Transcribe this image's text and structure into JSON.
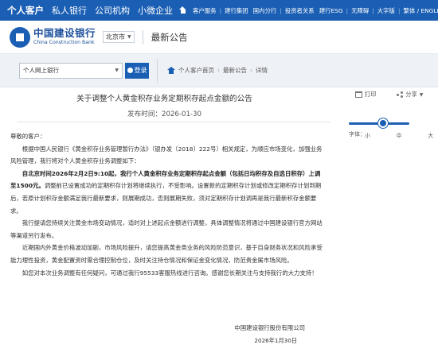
{
  "topbar": {
    "left_items": [
      "个人客户",
      "私人银行",
      "公司机构",
      "小微企业"
    ],
    "right_items": [
      "客户服务",
      "建行集团",
      "国内分行",
      "投资者关系",
      "建行ESG",
      "无障碍",
      "大字版",
      "繁体 / ENGLISH"
    ]
  },
  "header": {
    "logo_cn": "中国建设银行",
    "logo_en": "China Construction Bank",
    "region": "北京市",
    "title": "最新公告"
  },
  "band": {
    "login_select": "个人网上银行",
    "login_button": "登录",
    "breadcrumb": [
      "个人客户首页",
      "最新公告",
      "详情"
    ]
  },
  "article": {
    "title": "关于调整个人黄金积存业务定期积存起点金额的公告",
    "date": "发布时间：2026-01-30",
    "greeting": "尊敬的客户：",
    "p1": "根据中国人民银行《黄金积存业务管理暂行办法》（银办发〔2018〕222号）相关规定，为顺应市场变化，加强业务风险管理，我行将对个人黄金积存业务调整如下：",
    "p2_bold": "自北京时间2026年2月2日9:10起，我行个人黄金积存业务定期积存起点金额（包括日均积存及自选日积存）上调至1500元。",
    "p2_rest": "调整前已设置成功的定期积存计划将继续执行，不受影响。设置新的定期积存计划或修改定期积存计划到期后，若原计划积存金额满足我行最新要求，则展期成功，否则展期失败，须对定期积存计划调再是我行最新积存金额要求。",
    "p3": "我行提请您持续关注黄金市场变动情况，适时对上述起点金额进行调整，具体调整情况将通过中国建设银行官方网站等渠道另行发布。",
    "p4": "近期国内外黄金价格波动加剧，市场风险提升，请您提高黄金类业务的风险防范意识，基于自身财务状况和风险承受能力理性投资，黄金配置资时需合理控制仓位，及时关注持仓情况和保证金变化情况，防范贵金属市场风险。",
    "p5": "如您对本次业务调整有任何疑问，可通过我行95533客服热线进行咨询。感谢您长期关注与支持我行的大力支持！",
    "signature": "中国建设银行股份有限公司",
    "sign_date": "2026年1月30日"
  },
  "tools": {
    "print": "打印",
    "share": "分享",
    "font_label": "字体：",
    "sizes": [
      "小",
      "中",
      "大"
    ],
    "font_level": "中"
  }
}
